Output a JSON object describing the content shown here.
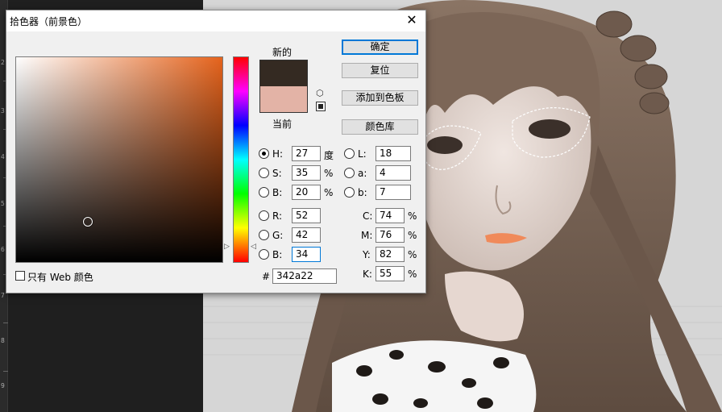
{
  "dialog": {
    "title": "拾色器（前景色）",
    "close_glyph": "✕",
    "new_label": "新的",
    "current_label": "当前",
    "new_color": "#342a22",
    "current_color": "#e3b3a6",
    "web_only_label": "只有 Web 颜色",
    "hash_label": "#",
    "hex_value": "342a22",
    "buttons": {
      "ok": "确定",
      "reset": "复位",
      "add_to_swatches": "添加到色板",
      "color_libraries": "颜色库"
    },
    "hsb": {
      "h": {
        "label": "H:",
        "value": "27",
        "unit": "度"
      },
      "s": {
        "label": "S:",
        "value": "35",
        "unit": "%"
      },
      "b": {
        "label": "B:",
        "value": "20",
        "unit": "%"
      }
    },
    "rgb": {
      "r": {
        "label": "R:",
        "value": "52"
      },
      "g": {
        "label": "G:",
        "value": "42"
      },
      "b": {
        "label": "B:",
        "value": "34"
      }
    },
    "lab": {
      "l": {
        "label": "L:",
        "value": "18"
      },
      "a": {
        "label": "a:",
        "value": "4"
      },
      "b": {
        "label": "b:",
        "value": "7"
      }
    },
    "cmyk": {
      "c": {
        "label": "C:",
        "value": "74",
        "unit": "%"
      },
      "m": {
        "label": "M:",
        "value": "76",
        "unit": "%"
      },
      "y": {
        "label": "Y:",
        "value": "82",
        "unit": "%"
      },
      "k": {
        "label": "K:",
        "value": "55",
        "unit": "%"
      }
    },
    "gamut_icon": "cube-icon",
    "web_safe_icon": "square-icon"
  },
  "ruler": {
    "numbers": [
      "2",
      "3",
      "4",
      "5",
      "6",
      "7",
      "8",
      "9"
    ]
  }
}
